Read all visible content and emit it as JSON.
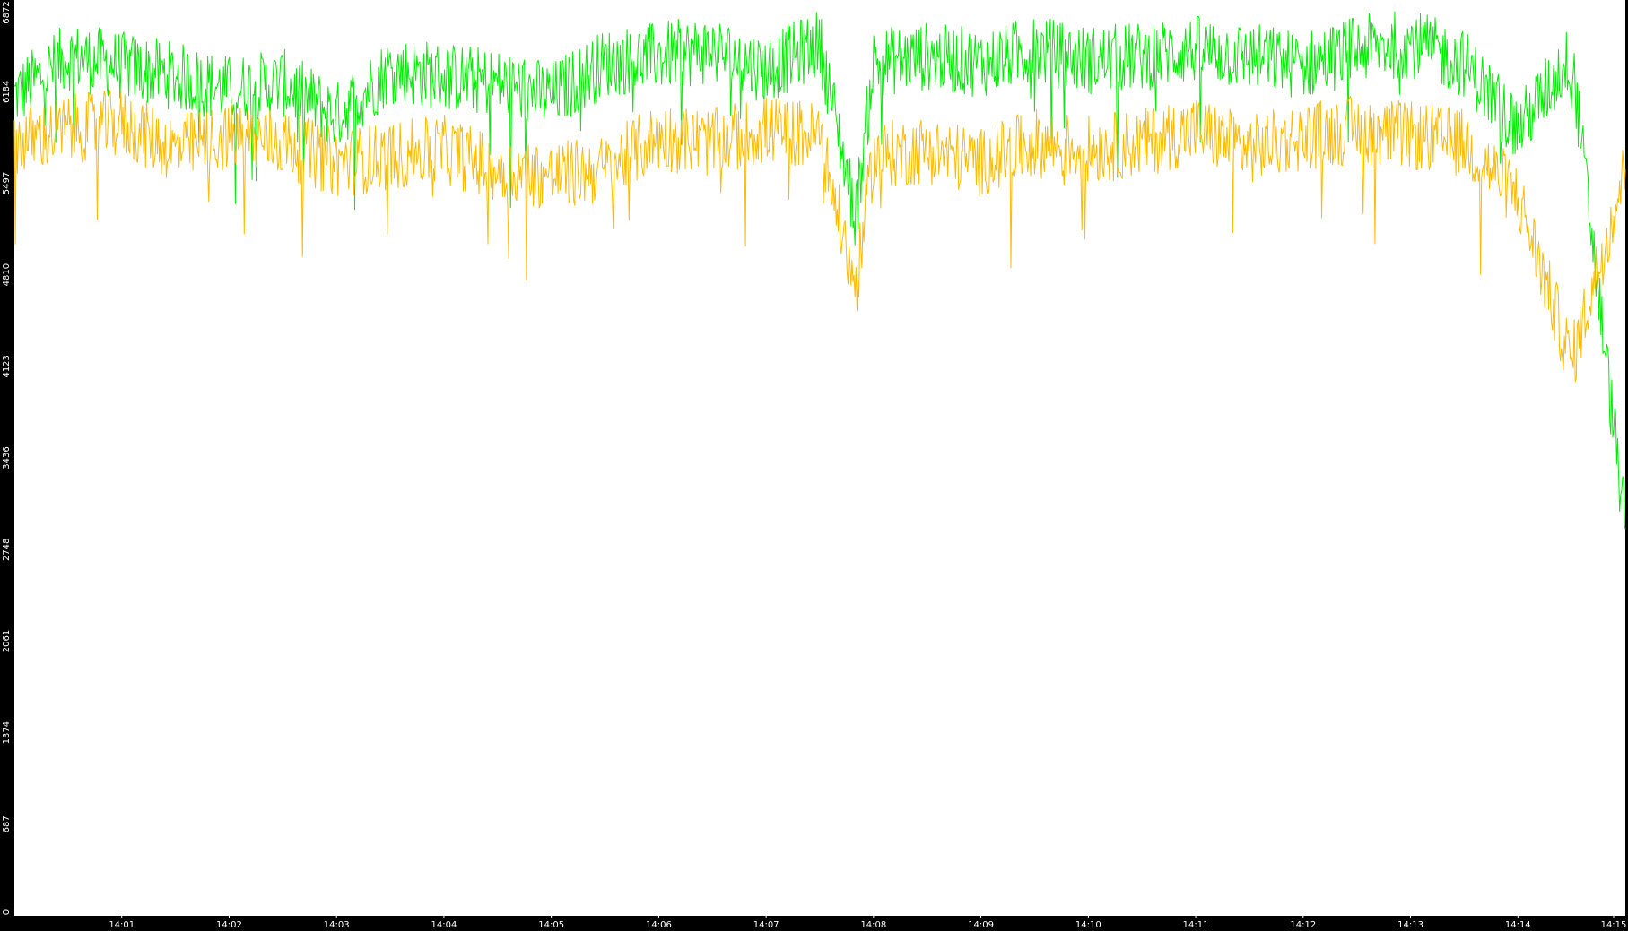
{
  "chart_data": {
    "type": "line",
    "title": "",
    "xlabel": "",
    "ylabel": "",
    "y_ticks": [
      "0",
      "687",
      "1374",
      "2061",
      "2748",
      "3436",
      "4123",
      "4810",
      "5497",
      "6184",
      "6872"
    ],
    "x_ticks": [
      "14:01",
      "14:02",
      "14:03",
      "14:04",
      "14:05",
      "14:06",
      "14:07",
      "14:08",
      "14:09",
      "14:10",
      "14:11",
      "14:12",
      "14:13",
      "14:14",
      "14:15"
    ],
    "ylim": [
      0,
      6872
    ],
    "xlim": [
      "14:00",
      "14:15"
    ],
    "grid": false,
    "background": "#ffffff",
    "frame_color": "#000000",
    "series": [
      {
        "color": "#00ee00",
        "x": [
          "14:00",
          "14:00:30",
          "14:01",
          "14:01:30",
          "14:02",
          "14:02:30",
          "14:03",
          "14:03:30",
          "14:04",
          "14:04:30",
          "14:05",
          "14:05:30",
          "14:06",
          "14:06:30",
          "14:07",
          "14:07:30",
          "14:07:50",
          "14:08",
          "14:08:30",
          "14:09",
          "14:09:30",
          "14:10",
          "14:10:30",
          "14:11",
          "14:11:30",
          "14:12",
          "14:12:30",
          "14:13",
          "14:13:30",
          "14:14",
          "14:14:30",
          "14:15"
        ],
        "y": [
          6150,
          6450,
          6380,
          6300,
          6200,
          6250,
          6000,
          6350,
          6300,
          6250,
          6150,
          6400,
          6450,
          6500,
          6350,
          6550,
          5250,
          6400,
          6450,
          6400,
          6500,
          6420,
          6450,
          6500,
          6450,
          6380,
          6500,
          6550,
          6400,
          5900,
          6450,
          2900
        ]
      },
      {
        "color": "#ffbb00",
        "x": [
          "14:00",
          "14:00:30",
          "14:01",
          "14:01:30",
          "14:02",
          "14:02:30",
          "14:03",
          "14:03:30",
          "14:04",
          "14:04:30",
          "14:05",
          "14:05:30",
          "14:06",
          "14:06:30",
          "14:07",
          "14:07:30",
          "14:07:50",
          "14:08",
          "14:08:30",
          "14:09",
          "14:09:30",
          "14:10",
          "14:10:30",
          "14:11",
          "14:11:30",
          "14:12",
          "14:12:30",
          "14:13",
          "14:13:30",
          "14:14",
          "14:14:30",
          "14:15"
        ],
        "y": [
          5800,
          5900,
          5950,
          5750,
          5850,
          5800,
          5650,
          5700,
          5750,
          5600,
          5550,
          5600,
          5850,
          5800,
          5900,
          5850,
          4700,
          5700,
          5750,
          5650,
          5800,
          5750,
          5800,
          5900,
          5750,
          5850,
          5900,
          5850,
          5800,
          5400,
          4150,
          5600
        ]
      }
    ]
  }
}
